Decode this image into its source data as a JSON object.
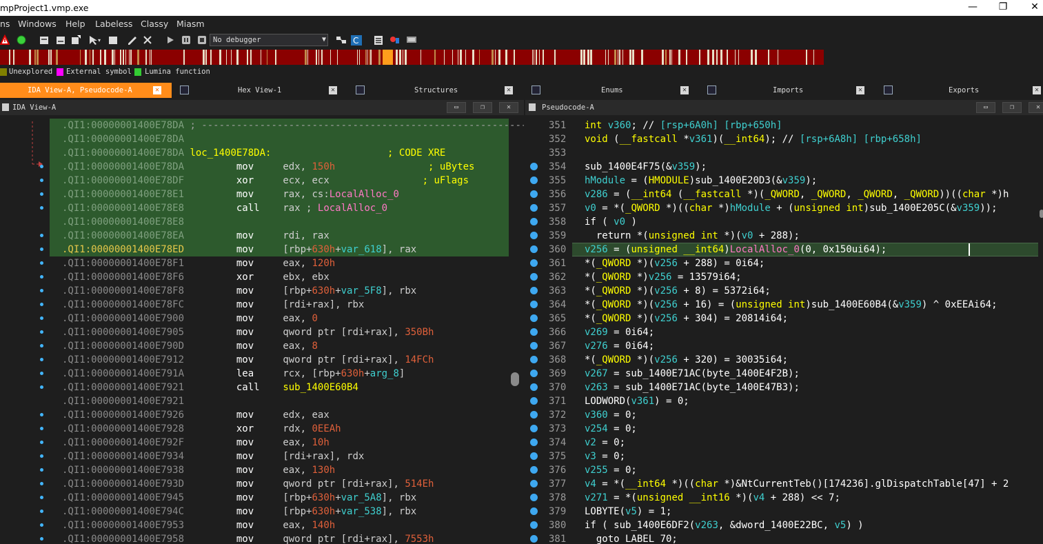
{
  "window": {
    "title": "mpProject1.vmp.exe",
    "minimize": "—",
    "maximize": "❐",
    "close": "✕"
  },
  "menu": [
    "ns",
    "Windows",
    "Help",
    "Labeless",
    "Classy",
    "Miasm"
  ],
  "toolbar": {
    "debugger": "No debugger"
  },
  "legend": [
    {
      "label": "Unexplored",
      "color": "#808000"
    },
    {
      "label": "External symbol",
      "color": "#ff00ff"
    },
    {
      "label": "Lumina function",
      "color": "#33cc33"
    }
  ],
  "tabs": [
    {
      "label": "IDA View-A, Pseudocode-A",
      "active": true
    },
    {
      "label": "Hex View-1"
    },
    {
      "label": "Structures"
    },
    {
      "label": "Enums"
    },
    {
      "label": "Imports"
    },
    {
      "label": "Exports"
    }
  ],
  "panes": {
    "ida": {
      "title": "IDA View-A"
    },
    "pseudo": {
      "title": "Pseudocode-A"
    }
  },
  "ida_lines": [
    [
      [
        "addr",
        ".QI1:00000001400E78DA"
      ],
      [
        "sep",
        " ; ---------------------------------------------------------"
      ]
    ],
    [
      [
        "addr",
        ".QI1:00000001400E78DA"
      ]
    ],
    [
      [
        "addr",
        ".QI1:00000001400E78DA"
      ],
      [
        "lbl",
        " loc_1400E78DA:"
      ],
      [
        "txt",
        "                    "
      ],
      [
        "cmt",
        "; CODE XRE"
      ]
    ],
    [
      [
        "addr",
        ".QI1:00000001400E78DA"
      ],
      [
        "mn",
        "         mov     "
      ],
      [
        "reg",
        "edx, "
      ],
      [
        "num",
        "150h"
      ],
      [
        "txt",
        "                "
      ],
      [
        "cmt",
        "; uBytes"
      ]
    ],
    [
      [
        "addr",
        ".QI1:00000001400E78DF"
      ],
      [
        "mn",
        "         xor     "
      ],
      [
        "reg",
        "ecx, ecx"
      ],
      [
        "txt",
        "                "
      ],
      [
        "cmt",
        "; uFlags"
      ]
    ],
    [
      [
        "addr",
        ".QI1:00000001400E78E1"
      ],
      [
        "mn",
        "         mov     "
      ],
      [
        "reg",
        "rax, cs:"
      ],
      [
        "imp",
        "LocalAlloc_0"
      ]
    ],
    [
      [
        "addr",
        ".QI1:00000001400E78E8"
      ],
      [
        "mn",
        "         call    "
      ],
      [
        "reg",
        "rax ; "
      ],
      [
        "imp",
        "LocalAlloc_0"
      ]
    ],
    [
      [
        "addr",
        ".QI1:00000001400E78E8"
      ]
    ],
    [
      [
        "addr",
        ".QI1:00000001400E78EA"
      ],
      [
        "mn",
        "         mov     "
      ],
      [
        "reg",
        "rdi, rax"
      ]
    ],
    [
      [
        "addry",
        ".QI1:00000001400E78ED"
      ],
      [
        "mn",
        "         mov     "
      ],
      [
        "reg",
        "[rbp+"
      ],
      [
        "num",
        "630h"
      ],
      [
        "reg",
        "+"
      ],
      [
        "var",
        "var_618"
      ],
      [
        "reg",
        "], rax"
      ]
    ],
    [
      [
        "addr",
        ".QI1:00000001400E78F1"
      ],
      [
        "mn",
        "         mov     "
      ],
      [
        "reg",
        "eax, "
      ],
      [
        "num",
        "120h"
      ]
    ],
    [
      [
        "addr",
        ".QI1:00000001400E78F6"
      ],
      [
        "mn",
        "         xor     "
      ],
      [
        "reg",
        "ebx, ebx"
      ]
    ],
    [
      [
        "addr",
        ".QI1:00000001400E78F8"
      ],
      [
        "mn",
        "         mov     "
      ],
      [
        "reg",
        "[rbp+"
      ],
      [
        "num",
        "630h"
      ],
      [
        "reg",
        "+"
      ],
      [
        "var",
        "var_5F8"
      ],
      [
        "reg",
        "], rbx"
      ]
    ],
    [
      [
        "addr",
        ".QI1:00000001400E78FC"
      ],
      [
        "mn",
        "         mov     "
      ],
      [
        "reg",
        "[rdi+rax], rbx"
      ]
    ],
    [
      [
        "addr",
        ".QI1:00000001400E7900"
      ],
      [
        "mn",
        "         mov     "
      ],
      [
        "reg",
        "eax, "
      ],
      [
        "num",
        "0"
      ]
    ],
    [
      [
        "addr",
        ".QI1:00000001400E7905"
      ],
      [
        "mn",
        "         mov     "
      ],
      [
        "reg",
        "qword ptr [rdi+rax], "
      ],
      [
        "num",
        "350Bh"
      ]
    ],
    [
      [
        "addr",
        ".QI1:00000001400E790D"
      ],
      [
        "mn",
        "         mov     "
      ],
      [
        "reg",
        "eax, "
      ],
      [
        "num",
        "8"
      ]
    ],
    [
      [
        "addr",
        ".QI1:00000001400E7912"
      ],
      [
        "mn",
        "         mov     "
      ],
      [
        "reg",
        "qword ptr [rdi+rax], "
      ],
      [
        "num",
        "14FCh"
      ]
    ],
    [
      [
        "addr",
        ".QI1:00000001400E791A"
      ],
      [
        "mn",
        "         lea     "
      ],
      [
        "reg",
        "rcx, [rbp+"
      ],
      [
        "num",
        "630h"
      ],
      [
        "reg",
        "+"
      ],
      [
        "var",
        "arg_8"
      ],
      [
        "reg",
        "]"
      ]
    ],
    [
      [
        "addr",
        ".QI1:00000001400E7921"
      ],
      [
        "mn",
        "         call    "
      ],
      [
        "lbl",
        "sub_1400E60B4"
      ]
    ],
    [
      [
        "addr",
        ".QI1:00000001400E7921"
      ]
    ],
    [
      [
        "addr",
        ".QI1:00000001400E7926"
      ],
      [
        "mn",
        "         mov     "
      ],
      [
        "reg",
        "edx, eax"
      ]
    ],
    [
      [
        "addr",
        ".QI1:00000001400E7928"
      ],
      [
        "mn",
        "         xor     "
      ],
      [
        "reg",
        "rdx, "
      ],
      [
        "num",
        "0EEAh"
      ]
    ],
    [
      [
        "addr",
        ".QI1:00000001400E792F"
      ],
      [
        "mn",
        "         mov     "
      ],
      [
        "reg",
        "eax, "
      ],
      [
        "num",
        "10h"
      ]
    ],
    [
      [
        "addr",
        ".QI1:00000001400E7934"
      ],
      [
        "mn",
        "         mov     "
      ],
      [
        "reg",
        "[rdi+rax], rdx"
      ]
    ],
    [
      [
        "addr",
        ".QI1:00000001400E7938"
      ],
      [
        "mn",
        "         mov     "
      ],
      [
        "reg",
        "eax, "
      ],
      [
        "num",
        "130h"
      ]
    ],
    [
      [
        "addr",
        ".QI1:00000001400E793D"
      ],
      [
        "mn",
        "         mov     "
      ],
      [
        "reg",
        "qword ptr [rdi+rax], "
      ],
      [
        "num",
        "514Eh"
      ]
    ],
    [
      [
        "addr",
        ".QI1:00000001400E7945"
      ],
      [
        "mn",
        "         mov     "
      ],
      [
        "reg",
        "[rbp+"
      ],
      [
        "num",
        "630h"
      ],
      [
        "reg",
        "+"
      ],
      [
        "var",
        "var_5A8"
      ],
      [
        "reg",
        "], rbx"
      ]
    ],
    [
      [
        "addr",
        ".QI1:00000001400E794C"
      ],
      [
        "mn",
        "         mov     "
      ],
      [
        "reg",
        "[rbp+"
      ],
      [
        "num",
        "630h"
      ],
      [
        "reg",
        "+"
      ],
      [
        "var",
        "var_538"
      ],
      [
        "reg",
        "], rbx"
      ]
    ],
    [
      [
        "addr",
        ".QI1:00000001400E7953"
      ],
      [
        "mn",
        "         mov     "
      ],
      [
        "reg",
        "eax, "
      ],
      [
        "num",
        "140h"
      ]
    ],
    [
      [
        "addr",
        ".QI1:00000001400E7958"
      ],
      [
        "mn",
        "         mov     "
      ],
      [
        "reg",
        "qword ptr [rdi+rax], "
      ],
      [
        "num",
        "7553h"
      ]
    ]
  ],
  "pseudo_lines": [
    {
      "n": "351",
      "bp": false,
      "t": [
        [
          "kw",
          "int "
        ],
        [
          "var",
          "v360"
        ],
        [
          "txt",
          "; // "
        ],
        [
          "var",
          "[rsp+6A0h] [rbp+650h]"
        ]
      ]
    },
    {
      "n": "352",
      "bp": false,
      "t": [
        [
          "kw",
          "void "
        ],
        [
          "txt",
          "("
        ],
        [
          "kw",
          "__fastcall "
        ],
        [
          "txt",
          "*"
        ],
        [
          "var",
          "v361"
        ],
        [
          "txt",
          ")("
        ],
        [
          "kw",
          "__int64"
        ],
        [
          "txt",
          "); // "
        ],
        [
          "var",
          "[rsp+6A8h] [rbp+658h]"
        ]
      ]
    },
    {
      "n": "353",
      "bp": false,
      "t": []
    },
    {
      "n": "354",
      "bp": true,
      "t": [
        [
          "txt",
          "sub_1400E4F75(&"
        ],
        [
          "var",
          "v359"
        ],
        [
          "txt",
          ");"
        ]
      ]
    },
    {
      "n": "355",
      "bp": true,
      "t": [
        [
          "var",
          "hModule"
        ],
        [
          "txt",
          " = ("
        ],
        [
          "kw",
          "HMODULE"
        ],
        [
          "txt",
          ")sub_1400E20D3(&"
        ],
        [
          "var",
          "v359"
        ],
        [
          "txt",
          ");"
        ]
      ]
    },
    {
      "n": "356",
      "bp": true,
      "t": [
        [
          "var",
          "v286"
        ],
        [
          "txt",
          " = ("
        ],
        [
          "kw",
          "__int64 "
        ],
        [
          "txt",
          "("
        ],
        [
          "kw",
          "__fastcall "
        ],
        [
          "txt",
          "*)("
        ],
        [
          "kw",
          "_QWORD"
        ],
        [
          "txt",
          ", "
        ],
        [
          "kw",
          "_QWORD"
        ],
        [
          "txt",
          ", "
        ],
        [
          "kw",
          "_QWORD"
        ],
        [
          "txt",
          ", "
        ],
        [
          "kw",
          "_QWORD"
        ],
        [
          "txt",
          "))(("
        ],
        [
          "kw",
          "char "
        ],
        [
          "txt",
          "*)h"
        ]
      ]
    },
    {
      "n": "357",
      "bp": true,
      "t": [
        [
          "var",
          "v0"
        ],
        [
          "txt",
          " = *("
        ],
        [
          "kw",
          "_QWORD "
        ],
        [
          "txt",
          "*)(("
        ],
        [
          "kw",
          "char "
        ],
        [
          "txt",
          "*)"
        ],
        [
          "var",
          "hModule"
        ],
        [
          "txt",
          " + ("
        ],
        [
          "kw",
          "unsigned int"
        ],
        [
          "txt",
          ")sub_1400E205C(&"
        ],
        [
          "var",
          "v359"
        ],
        [
          "txt",
          "));"
        ]
      ]
    },
    {
      "n": "358",
      "bp": true,
      "t": [
        [
          "txt",
          "if ( "
        ],
        [
          "var",
          "v0"
        ],
        [
          "txt",
          " )"
        ]
      ]
    },
    {
      "n": "359",
      "bp": true,
      "t": [
        [
          "txt",
          "  return *("
        ],
        [
          "kw",
          "unsigned int "
        ],
        [
          "txt",
          "*)("
        ],
        [
          "var",
          "v0"
        ],
        [
          "txt",
          " + 288);"
        ]
      ]
    },
    {
      "n": "360",
      "bp": true,
      "t": [
        [
          "var",
          "v256"
        ],
        [
          "txt",
          " = ("
        ],
        [
          "kw",
          "unsigned __int64"
        ],
        [
          "txt",
          ")"
        ],
        [
          "imp",
          "LocalAlloc_0"
        ],
        [
          "txt",
          "(0, 0x150ui64);"
        ]
      ]
    },
    {
      "n": "361",
      "bp": true,
      "t": [
        [
          "txt",
          "*("
        ],
        [
          "kw",
          "_QWORD "
        ],
        [
          "txt",
          "*)("
        ],
        [
          "var",
          "v256"
        ],
        [
          "txt",
          " + 288) = 0i64;"
        ]
      ]
    },
    {
      "n": "362",
      "bp": true,
      "t": [
        [
          "txt",
          "*("
        ],
        [
          "kw",
          "_QWORD "
        ],
        [
          "txt",
          "*)"
        ],
        [
          "var",
          "v256"
        ],
        [
          "txt",
          " = 13579i64;"
        ]
      ]
    },
    {
      "n": "363",
      "bp": true,
      "t": [
        [
          "txt",
          "*("
        ],
        [
          "kw",
          "_QWORD "
        ],
        [
          "txt",
          "*)("
        ],
        [
          "var",
          "v256"
        ],
        [
          "txt",
          " + 8) = 5372i64;"
        ]
      ]
    },
    {
      "n": "364",
      "bp": true,
      "t": [
        [
          "txt",
          "*("
        ],
        [
          "kw",
          "_QWORD "
        ],
        [
          "txt",
          "*)("
        ],
        [
          "var",
          "v256"
        ],
        [
          "txt",
          " + 16) = ("
        ],
        [
          "kw",
          "unsigned int"
        ],
        [
          "txt",
          ")sub_1400E60B4(&"
        ],
        [
          "var",
          "v359"
        ],
        [
          "txt",
          ") ^ 0xEEAi64;"
        ]
      ]
    },
    {
      "n": "365",
      "bp": true,
      "t": [
        [
          "txt",
          "*("
        ],
        [
          "kw",
          "_QWORD "
        ],
        [
          "txt",
          "*)("
        ],
        [
          "var",
          "v256"
        ],
        [
          "txt",
          " + 304) = 20814i64;"
        ]
      ]
    },
    {
      "n": "366",
      "bp": true,
      "t": [
        [
          "var",
          "v269"
        ],
        [
          "txt",
          " = 0i64;"
        ]
      ]
    },
    {
      "n": "367",
      "bp": true,
      "t": [
        [
          "var",
          "v276"
        ],
        [
          "txt",
          " = 0i64;"
        ]
      ]
    },
    {
      "n": "368",
      "bp": true,
      "t": [
        [
          "txt",
          "*("
        ],
        [
          "kw",
          "_QWORD "
        ],
        [
          "txt",
          "*)("
        ],
        [
          "var",
          "v256"
        ],
        [
          "txt",
          " + 320) = 30035i64;"
        ]
      ]
    },
    {
      "n": "369",
      "bp": true,
      "t": [
        [
          "var",
          "v267"
        ],
        [
          "txt",
          " = sub_1400E71AC(byte_1400E4F2B);"
        ]
      ]
    },
    {
      "n": "370",
      "bp": true,
      "t": [
        [
          "var",
          "v263"
        ],
        [
          "txt",
          " = sub_1400E71AC(byte_1400E47B3);"
        ]
      ]
    },
    {
      "n": "371",
      "bp": true,
      "t": [
        [
          "txt",
          "LODWORD("
        ],
        [
          "var",
          "v361"
        ],
        [
          "txt",
          ") = 0;"
        ]
      ]
    },
    {
      "n": "372",
      "bp": true,
      "t": [
        [
          "var",
          "v360"
        ],
        [
          "txt",
          " = 0;"
        ]
      ]
    },
    {
      "n": "373",
      "bp": true,
      "t": [
        [
          "var",
          "v254"
        ],
        [
          "txt",
          " = 0;"
        ]
      ]
    },
    {
      "n": "374",
      "bp": true,
      "t": [
        [
          "var",
          "v2"
        ],
        [
          "txt",
          " = 0;"
        ]
      ]
    },
    {
      "n": "375",
      "bp": true,
      "t": [
        [
          "var",
          "v3"
        ],
        [
          "txt",
          " = 0;"
        ]
      ]
    },
    {
      "n": "376",
      "bp": true,
      "t": [
        [
          "var",
          "v255"
        ],
        [
          "txt",
          " = 0;"
        ]
      ]
    },
    {
      "n": "377",
      "bp": true,
      "t": [
        [
          "var",
          "v4"
        ],
        [
          "txt",
          " = *("
        ],
        [
          "kw",
          "__int64 "
        ],
        [
          "txt",
          "*)(("
        ],
        [
          "kw",
          "char "
        ],
        [
          "txt",
          "*)&NtCurrentTeb()[174236].glDispatchTable[47] + 2"
        ]
      ]
    },
    {
      "n": "378",
      "bp": true,
      "t": [
        [
          "var",
          "v271"
        ],
        [
          "txt",
          " = *("
        ],
        [
          "kw",
          "unsigned __int16 "
        ],
        [
          "txt",
          "*)("
        ],
        [
          "var",
          "v4"
        ],
        [
          "txt",
          " + 288) << 7;"
        ]
      ]
    },
    {
      "n": "379",
      "bp": true,
      "t": [
        [
          "txt",
          "LOBYTE("
        ],
        [
          "var",
          "v5"
        ],
        [
          "txt",
          ") = 1;"
        ]
      ]
    },
    {
      "n": "380",
      "bp": true,
      "t": [
        [
          "txt",
          "if ( sub_1400E6DF2("
        ],
        [
          "var",
          "v263"
        ],
        [
          "txt",
          ", &dword_1400E22BC, "
        ],
        [
          "var",
          "v5"
        ],
        [
          "txt",
          ") )"
        ]
      ]
    },
    {
      "n": "381",
      "bp": true,
      "t": [
        [
          "txt",
          "  goto LABEL_70;"
        ]
      ]
    }
  ]
}
